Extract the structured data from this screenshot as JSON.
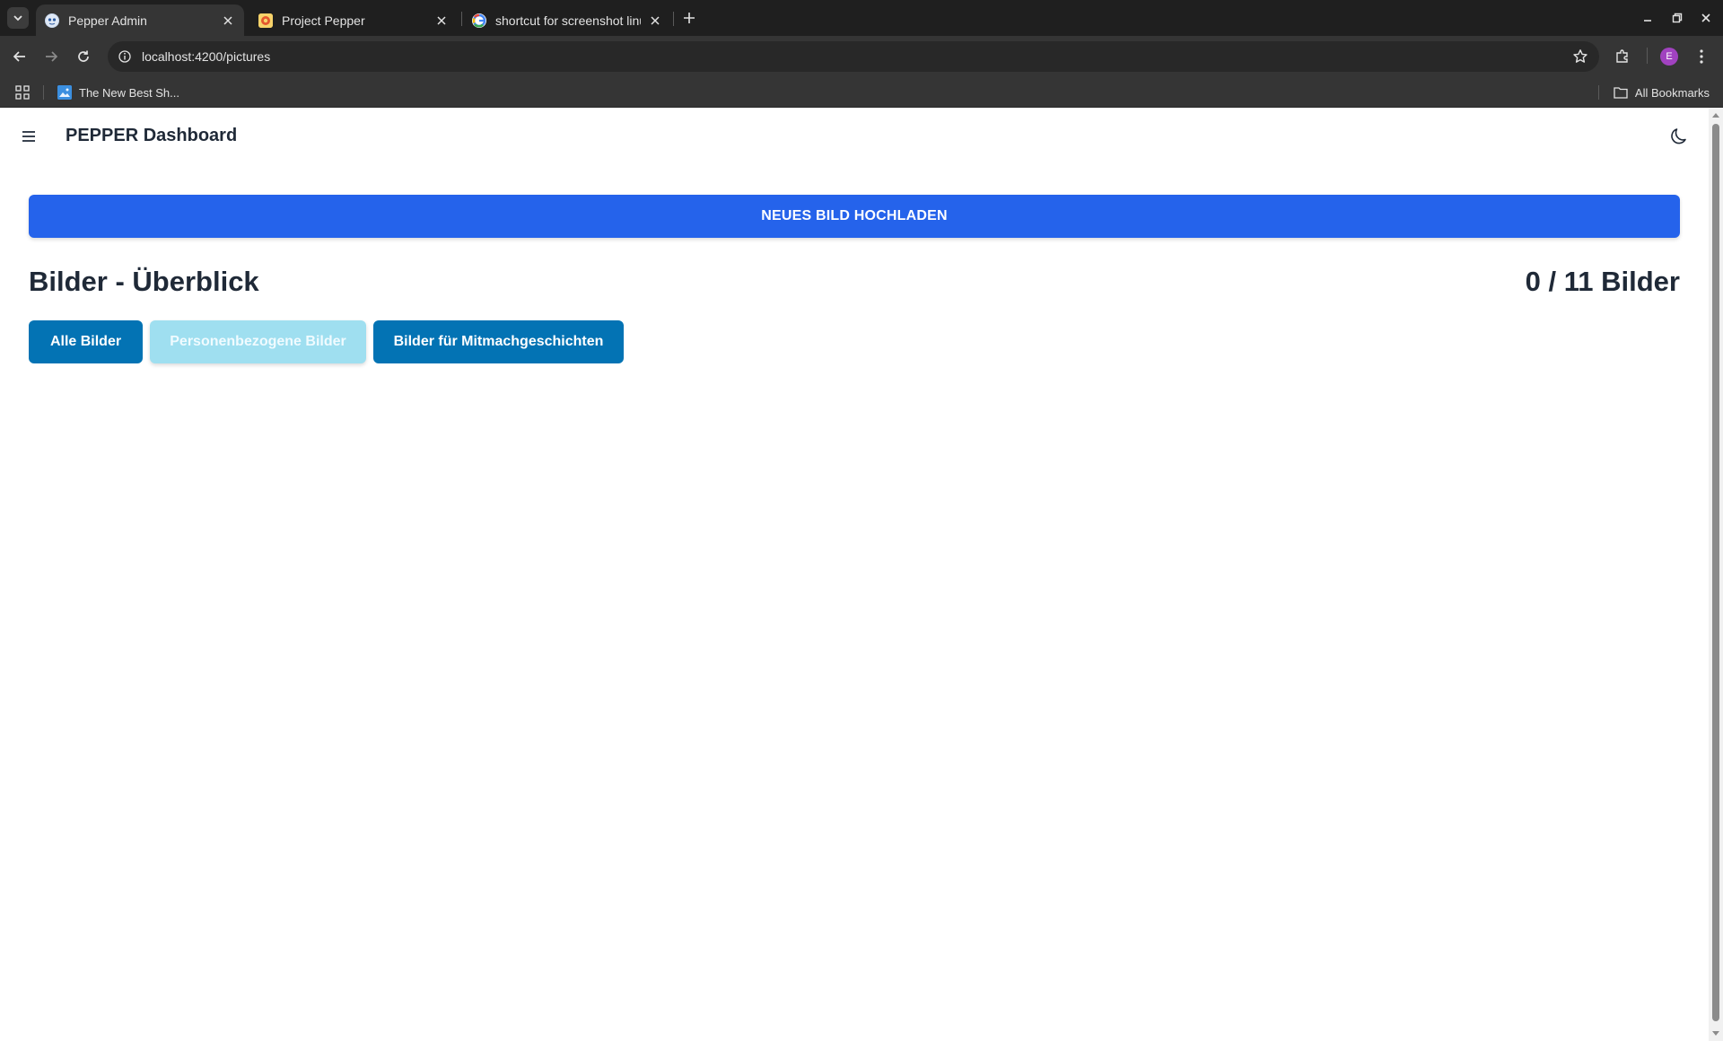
{
  "browser": {
    "tabs": [
      {
        "title": "Pepper Admin",
        "active": true
      },
      {
        "title": "Project Pepper",
        "active": false
      },
      {
        "title": "shortcut for screenshot linu",
        "active": false
      }
    ],
    "url": "localhost:4200/pictures",
    "profile_initial": "E",
    "bookmarks": [
      {
        "label": "The New Best Sh..."
      }
    ],
    "all_bookmarks_label": "All Bookmarks"
  },
  "app": {
    "title": "PEPPER Dashboard",
    "upload_label": "NEUES BILD HOCHLADEN",
    "section_title": "Bilder - Überblick",
    "count_label": "0 / 11 Bilder",
    "filters": [
      {
        "label": "Alle Bilder",
        "state": "active"
      },
      {
        "label": "Personenbezogene Bilder",
        "state": "muted"
      },
      {
        "label": "Bilder für Mitmachgeschichten",
        "state": "active"
      }
    ]
  },
  "colors": {
    "primary": "#2563eb",
    "filter_active": "#0373b4",
    "filter_muted": "#9fdff0",
    "heading": "#1f2937"
  }
}
